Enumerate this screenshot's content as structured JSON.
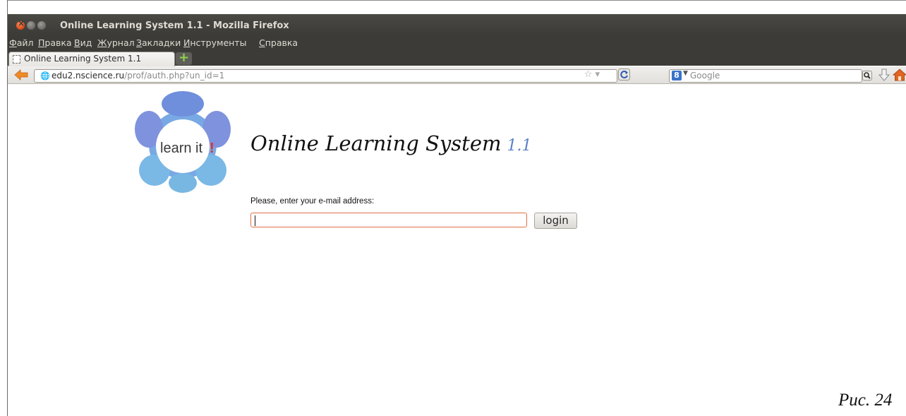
{
  "window": {
    "title": "Online Learning System 1.1 - Mozilla Firefox"
  },
  "menu": {
    "items": [
      {
        "label": "Файл"
      },
      {
        "label": "Правка"
      },
      {
        "label": "Вид"
      },
      {
        "label": "Журнал"
      },
      {
        "label": "Закладки"
      },
      {
        "label": "Инструменты"
      },
      {
        "label": "Справка"
      }
    ]
  },
  "tabs": [
    {
      "label": "Online Learning System 1.1"
    }
  ],
  "navbar": {
    "url_host": "edu2.nscience.ru",
    "url_path": "/prof/auth.php?un_id=1",
    "url_scheme_hidden": "",
    "search_placeholder": "Google"
  },
  "page": {
    "logo_text": "learn it",
    "logo_mark": "!",
    "title": "Online Learning System",
    "version": "1.1",
    "email_label": "Please, enter your e-mail address:",
    "email_value": "",
    "login_label": "login"
  },
  "caption": "Рис. 24",
  "colors": {
    "titlebar": "#3c3b37",
    "version_accent": "#5b7fc9",
    "logo_blue": "#6f8fdc",
    "logo_light": "#79b7e3",
    "input_focus_border": "#e07045",
    "logo_exclaim": "#e0312a"
  },
  "icons": {
    "back": "back-arrow-icon",
    "globe": "globe-icon",
    "bookmark_star": "star-icon",
    "reload": "reload-icon",
    "search_engine": "google-icon",
    "search": "magnifier-icon",
    "downloads": "download-arrow-icon",
    "home": "home-icon"
  }
}
